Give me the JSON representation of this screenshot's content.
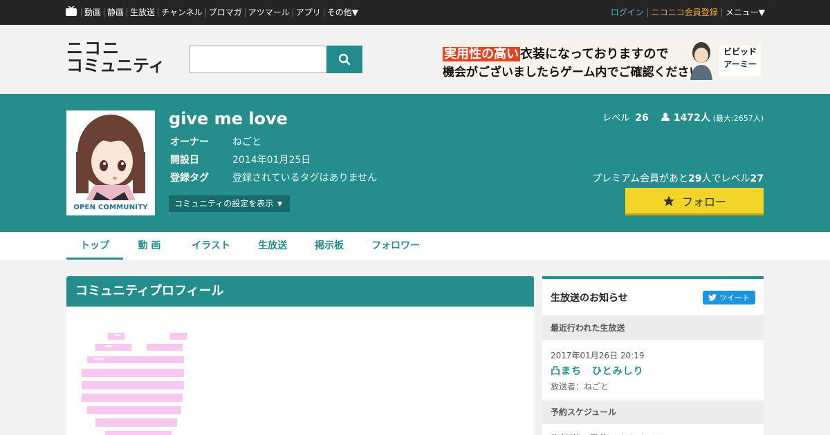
{
  "topnav": {
    "links": [
      "動画",
      "静画",
      "生放送",
      "チャンネル",
      "ブロマガ",
      "アツマール",
      "アプリ",
      "その他▼"
    ],
    "login": "ログイン",
    "register": "ニコニコ会員登録",
    "menu": "メニュー▼"
  },
  "header": {
    "logo_line1": "ニコニ",
    "logo_line2": "コミュニティ",
    "search_placeholder": "",
    "ad": {
      "highlight": "実用性の高い",
      "line1_rest": "衣装になっておりますので",
      "line2": "機会がございましたらゲーム内でご確認ください。",
      "brand_line1": "ビビッド",
      "brand_line2": "アーミー"
    }
  },
  "community": {
    "title": "give me love",
    "thumb_label": "OPEN COMMUNITY",
    "info": [
      {
        "key": "オーナー",
        "value": "ねごと"
      },
      {
        "key": "開設日",
        "value": "2014年01月25日"
      },
      {
        "key": "登録タグ",
        "value": "登録されているタグはありません"
      }
    ],
    "settings_button": "コミュニティの設定を表示 ▼",
    "level_label": "レベル",
    "level": "26",
    "members": "1472人",
    "max_members": "(最大:2657人)",
    "premium_prefix": "プレミアム会員があと",
    "premium_count": "29",
    "premium_middle": "人でレベル",
    "premium_level": "27",
    "follow_button": "フォロー"
  },
  "tabs": [
    "トップ",
    "動 画",
    "イラスト",
    "生放送",
    "掲示板",
    "フォロワー"
  ],
  "profile": {
    "heading": "コミュニティプロフィール"
  },
  "side": {
    "heading": "生放送のお知らせ",
    "tweet_button": "ツイート",
    "recent_heading": "最近行われた生放送",
    "recent": {
      "date": "2017年01月26日 20:19",
      "title": "凸まち　ひとみしり",
      "by": "放送者：ねごと"
    },
    "schedule_heading": "予約スケジュール",
    "schedule_empty": "生放送の予約はありません"
  },
  "colors": {
    "brand": "#258d8c",
    "follow": "#f3d52a",
    "login": "#4ab6d4",
    "register": "#f2a93b",
    "tweet": "#1b95e0"
  }
}
